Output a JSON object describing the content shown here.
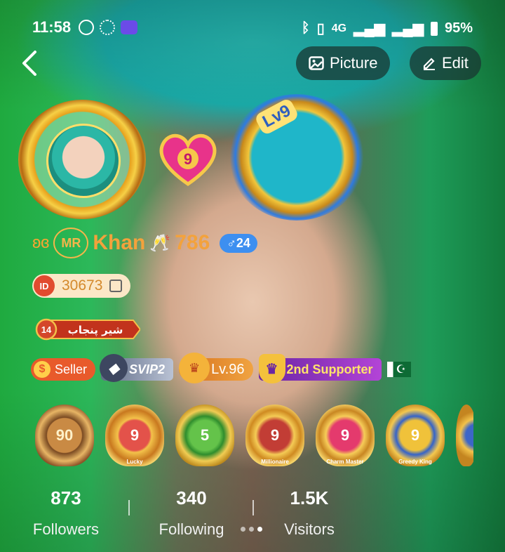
{
  "status_bar": {
    "time": "11:58",
    "battery": "95%",
    "network": "4G"
  },
  "header": {
    "picture_label": "Picture",
    "edit_label": "Edit"
  },
  "profile": {
    "level_badge": "Lv9",
    "heart_level": "9",
    "name_logo": "MR",
    "name": "Khan",
    "name_number": "786",
    "gender_age": "♂24",
    "id": "30673",
    "family_label": "شیر پنجاب",
    "family_level": "14"
  },
  "badges": {
    "seller": "Seller",
    "svip": "SVIP2",
    "level": "Lv.96",
    "supporter": "2nd Supporter"
  },
  "medals": [
    {
      "value": "90",
      "caption": ""
    },
    {
      "value": "9",
      "caption": "Lucky"
    },
    {
      "value": "5",
      "caption": ""
    },
    {
      "value": "9",
      "caption": "Millionaire"
    },
    {
      "value": "9",
      "caption": "Charm Master"
    },
    {
      "value": "9",
      "caption": "Greedy King"
    }
  ],
  "stats": {
    "followers_count": "873",
    "followers_label": "Followers",
    "following_count": "340",
    "following_label": "Following",
    "visitors_count": "1.5K",
    "visitors_label": "Visitors"
  },
  "colors": {
    "accent_orange": "#f3a23c",
    "gender_blue": "#3d8ff0",
    "pill_dark": "#19372f"
  }
}
